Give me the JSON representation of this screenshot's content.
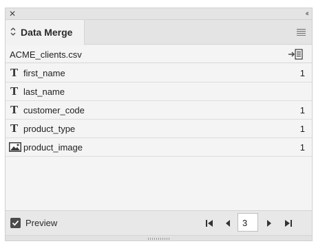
{
  "topbar": {
    "close_icon": "close-icon",
    "collapse_icon": "double-chevron-left-icon"
  },
  "panel": {
    "title": "Data Merge",
    "menu_icon": "panel-menu-icon"
  },
  "source": {
    "file_name": "ACME_clients.csv",
    "import_icon": "import-data-icon"
  },
  "fields": [
    {
      "name": "first_name",
      "type": "text",
      "icon": "text-field-icon",
      "count": "1"
    },
    {
      "name": "last_name",
      "type": "text",
      "icon": "text-field-icon",
      "count": ""
    },
    {
      "name": "customer_code",
      "type": "text",
      "icon": "text-field-icon",
      "count": "1"
    },
    {
      "name": "product_type",
      "type": "text",
      "icon": "text-field-icon",
      "count": "1"
    },
    {
      "name": "product_image",
      "type": "image",
      "icon": "image-field-icon",
      "count": "1"
    }
  ],
  "footer": {
    "preview_label": "Preview",
    "preview_checked": true,
    "record_number": "3",
    "nav_icons": [
      "first-record-icon",
      "previous-record-icon",
      "next-record-icon",
      "last-record-icon"
    ]
  },
  "text_icon_glyph": "T"
}
